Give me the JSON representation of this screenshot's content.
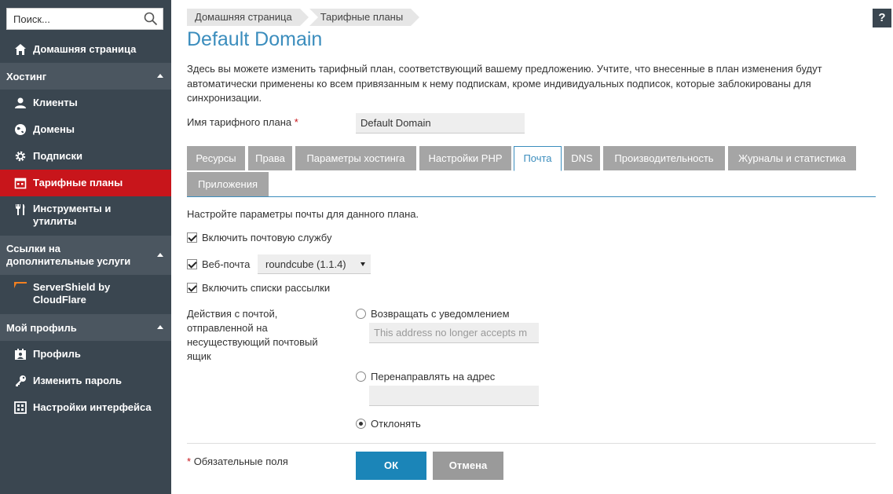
{
  "search": {
    "placeholder": "Поиск..."
  },
  "sidebar": {
    "home": "Домашняя страница",
    "sections": [
      {
        "title": "Хостинг"
      },
      {
        "title": "Ссылки на дополнительные услуги"
      },
      {
        "title": "Мой профиль"
      }
    ],
    "hosting_items": [
      {
        "label": "Клиенты",
        "icon": "user-icon"
      },
      {
        "label": "Домены",
        "icon": "globe-icon"
      },
      {
        "label": "Подписки",
        "icon": "gear-icon"
      },
      {
        "label": "Тарифные планы",
        "icon": "calendar-icon",
        "active": true
      },
      {
        "label": "Инструменты и утилиты",
        "icon": "tools-icon"
      }
    ],
    "links_items": [
      {
        "label": "ServerShield by CloudFlare",
        "icon": "cloudflare-icon"
      }
    ],
    "profile_items": [
      {
        "label": "Профиль",
        "icon": "profile-card-icon"
      },
      {
        "label": "Изменить пароль",
        "icon": "key-icon"
      },
      {
        "label": "Настройки интерфейса",
        "icon": "grid-icon"
      }
    ],
    "active_color": "#c8151b"
  },
  "breadcrumb": [
    "Домашняя страница",
    "Тарифные планы"
  ],
  "help": "?",
  "page": {
    "title": "Default Domain",
    "description": "Здесь вы можете изменить тарифный план, соответствующий вашему предложению. Учтите, что внесенные в план изменения будут автоматически применены ко всем привязанным к нему подпискам, кроме индивидуальных подписок, которые заблокированы для синхронизации.",
    "plan_name_label": "Имя тарифного плана",
    "required_mark": "*",
    "plan_name_value": "Default Domain"
  },
  "tabs": [
    "Ресурсы",
    "Права",
    "Параметры хостинга",
    "Настройки PHP",
    "Почта",
    "DNS",
    "Производительность",
    "Журналы и статистика",
    "Приложения"
  ],
  "active_tab": "Почта",
  "mail": {
    "hint": "Настройте параметры почты для данного плана.",
    "enable_mail": {
      "label": "Включить почтовую службу",
      "checked": true
    },
    "webmail": {
      "label": "Веб-почта",
      "checked": true,
      "selected": "roundcube (1.1.4)"
    },
    "mailing_lists": {
      "label": "Включить списки рассылки",
      "checked": true
    },
    "actions_label": "Действия с почтой, отправленной на несуществующий почтовый ящик",
    "bounce": {
      "label": "Возвращать с уведомлением",
      "placeholder": "This address no longer accepts m",
      "selected": false
    },
    "forward": {
      "label": "Перенаправлять на адрес",
      "value": "",
      "selected": false
    },
    "reject": {
      "label": "Отклонять",
      "selected": true
    }
  },
  "footer": {
    "required_note": "Обязательные поля",
    "ok": "ОК",
    "cancel": "Отмена"
  },
  "colors": {
    "accent": "#3b8dbd",
    "ok_button": "#1b85b8",
    "sidebar": "#3a4650"
  }
}
